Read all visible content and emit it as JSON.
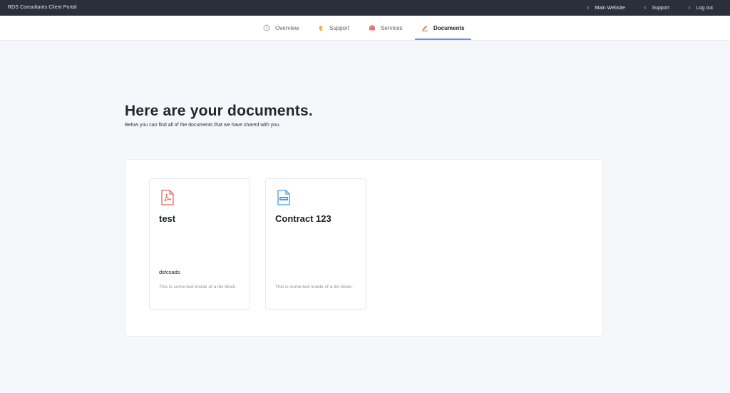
{
  "topbar": {
    "brand": "RDS Consultants Client Portal",
    "links": [
      "Main Website",
      "Support",
      "Log out"
    ]
  },
  "tabs": [
    {
      "label": "Overview",
      "icon": "clock-icon"
    },
    {
      "label": "Support",
      "icon": "bell-icon"
    },
    {
      "label": "Services",
      "icon": "briefcase-icon"
    },
    {
      "label": "Documents",
      "icon": "pen-icon",
      "active": true
    }
  ],
  "page": {
    "title": "Here are your documents.",
    "subtitle": "Below you can find all of the documents that we have shared with you."
  },
  "documents": [
    {
      "title": "test",
      "note": "dsfcsads",
      "description": "This is some text inside of a div block.",
      "icon": "pdf-file-icon"
    },
    {
      "title": "Contract 123",
      "note": "",
      "description": "This is some text inside of a div block.",
      "icon": "doc-file-icon"
    }
  ],
  "colors": {
    "topbar_bg": "#2b2f3a",
    "accent": "#6f8fe0",
    "pdf_red": "#e0685f",
    "doc_blue": "#3f9fe6",
    "page_bg": "#f6f7fb"
  }
}
